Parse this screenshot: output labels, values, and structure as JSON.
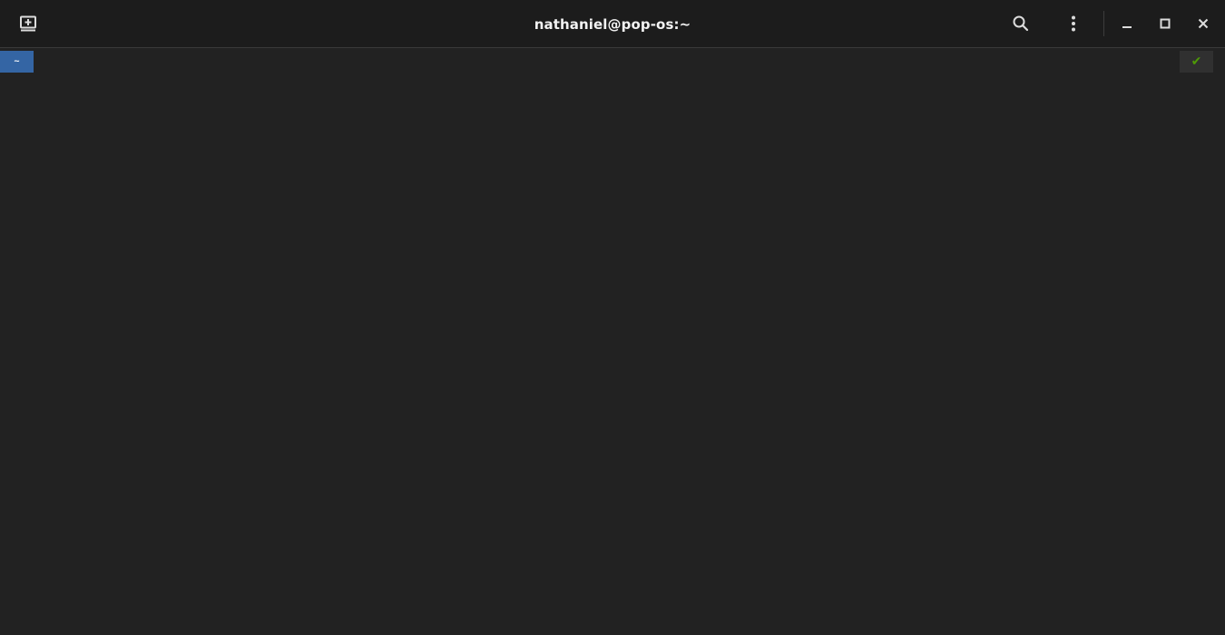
{
  "window": {
    "title": "nathaniel@pop-os:~"
  },
  "headerbar": {
    "new_tab_icon": "new-tab-icon",
    "search_icon": "search-icon",
    "menu_icon": "kebab-menu-icon",
    "minimize_icon": "minimize-icon",
    "maximize_icon": "maximize-icon",
    "close_icon": "close-icon"
  },
  "terminal": {
    "prompt_dir": "~",
    "prompt_color": "#3465a4",
    "status_symbol": "✔",
    "status_color": "#4e9a06",
    "background": "#222222"
  }
}
